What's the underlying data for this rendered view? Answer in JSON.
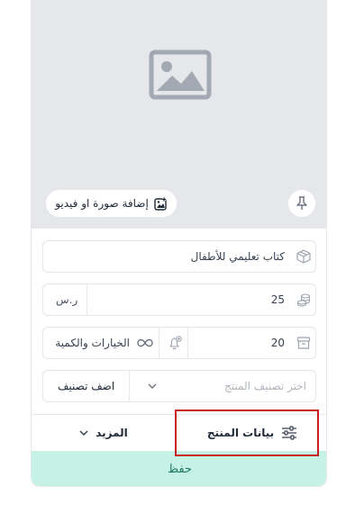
{
  "media": {
    "add_label": "إضافة صورة او فيديو"
  },
  "product": {
    "name": "كتاب تعليمي للأطفال",
    "price": "25",
    "currency": "ر.س",
    "quantity": "20",
    "options_label": "الخيارات والكمية",
    "category_placeholder": "اختر تصنيف المنتج",
    "add_category_label": "اضف تصنيف"
  },
  "tabs": {
    "product_data": "بيانات المنتج",
    "more": "المزيد"
  },
  "save_label": "حفظ",
  "colors": {
    "accent": "#c6f2e6",
    "accent_text": "#1f7a63",
    "highlight": "#c81e1e"
  }
}
